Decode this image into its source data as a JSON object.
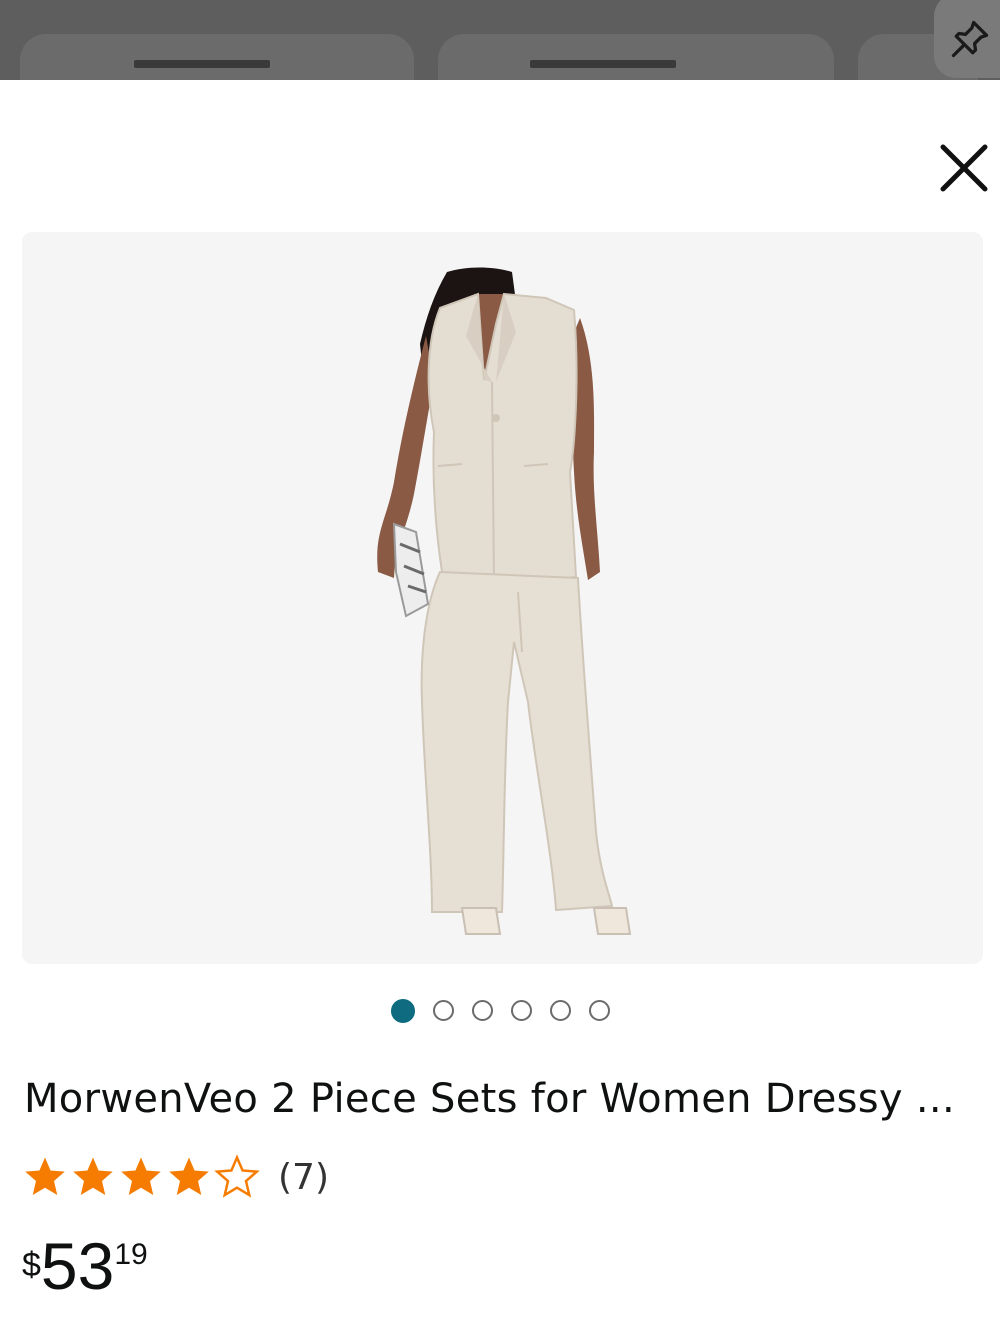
{
  "product": {
    "title": "MorwenVeo 2 Piece Sets for Women Dressy ...",
    "rating": 4.5,
    "rating_max": 5,
    "rating_count": "(7)",
    "price": {
      "symbol": "$",
      "whole": "53",
      "fraction": "19"
    }
  },
  "carousel": {
    "total": 6,
    "active_index": 0
  },
  "icons": {
    "pin": "pin-icon",
    "close": "close-icon",
    "star": "star-icon"
  },
  "colors": {
    "star": "#f57c00",
    "active_dot": "#0e6b80",
    "text": "#0f1111",
    "overlay": "#5e5e5e",
    "image_bg": "#f5f5f5"
  }
}
